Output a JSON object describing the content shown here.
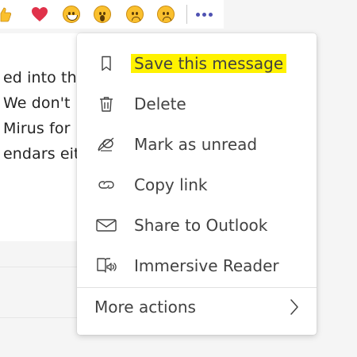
{
  "reactions": [
    {
      "name": "like"
    },
    {
      "name": "heart"
    },
    {
      "name": "laugh"
    },
    {
      "name": "surprised"
    },
    {
      "name": "sad"
    },
    {
      "name": "angry"
    }
  ],
  "message": {
    "lines": [
      "ed into th",
      " We don't",
      " Mirus for",
      "endars eith"
    ]
  },
  "menu": {
    "items": [
      {
        "label": "Save this message",
        "icon": "bookmark-icon",
        "highlighted": true
      },
      {
        "label": "Delete",
        "icon": "trash-icon"
      },
      {
        "label": "Mark as unread",
        "icon": "unread-icon"
      },
      {
        "label": "Copy link",
        "icon": "link-icon"
      },
      {
        "label": "Share to Outlook",
        "icon": "mail-icon"
      },
      {
        "label": "Immersive Reader",
        "icon": "immersive-reader-icon"
      }
    ],
    "more_actions": "More actions"
  },
  "colors": {
    "highlight": "#fff200",
    "accent": "#4f52b2",
    "emoji": "#fac02e",
    "heart": "#e0324a"
  }
}
